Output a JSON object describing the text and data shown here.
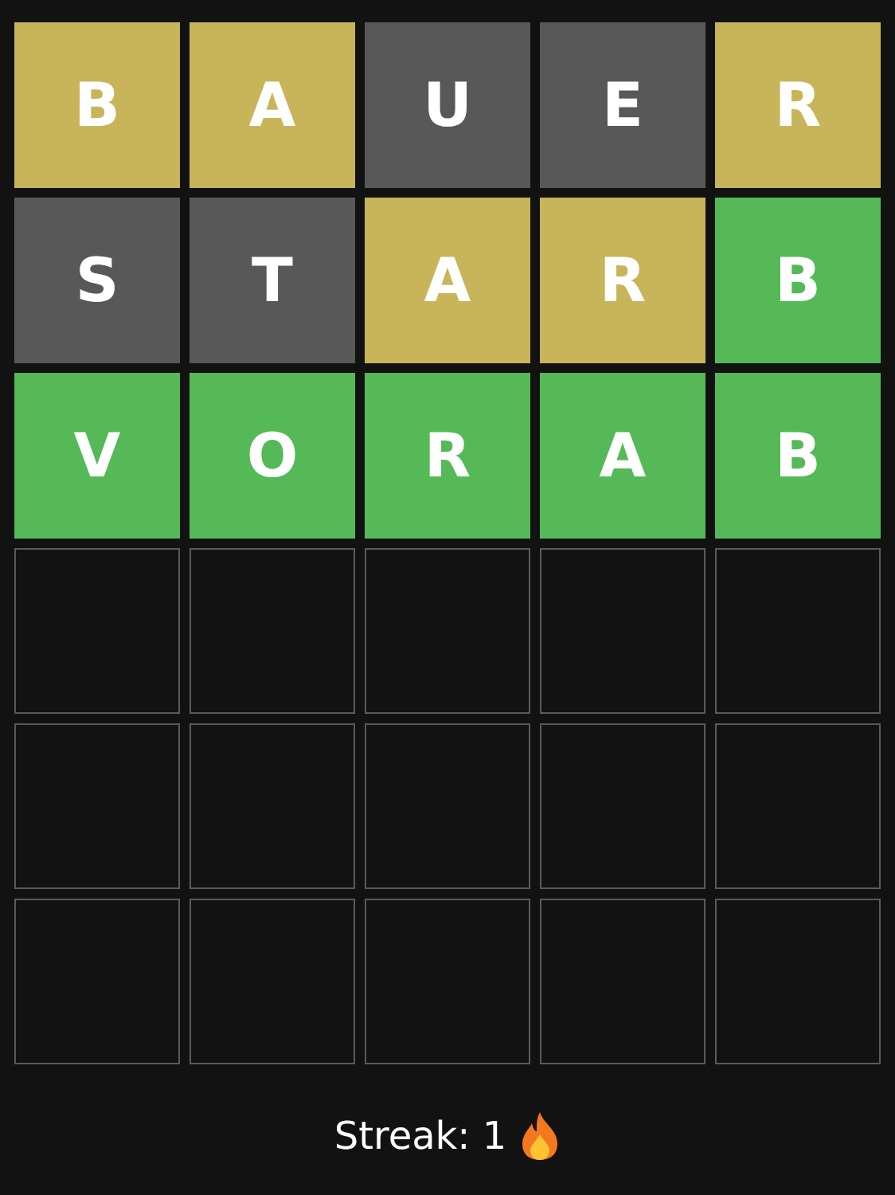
{
  "board": [
    [
      {
        "letter": "B",
        "kind": "present"
      },
      {
        "letter": "A",
        "kind": "present"
      },
      {
        "letter": "U",
        "kind": "absent"
      },
      {
        "letter": "E",
        "kind": "absent"
      },
      {
        "letter": "R",
        "kind": "present"
      }
    ],
    [
      {
        "letter": "S",
        "kind": "absent"
      },
      {
        "letter": "T",
        "kind": "absent"
      },
      {
        "letter": "A",
        "kind": "present"
      },
      {
        "letter": "R",
        "kind": "present"
      },
      {
        "letter": "B",
        "kind": "correct"
      }
    ],
    [
      {
        "letter": "V",
        "kind": "correct"
      },
      {
        "letter": "O",
        "kind": "correct"
      },
      {
        "letter": "R",
        "kind": "correct"
      },
      {
        "letter": "A",
        "kind": "correct"
      },
      {
        "letter": "B",
        "kind": "correct"
      }
    ],
    [
      {
        "kind": "empty"
      },
      {
        "kind": "empty"
      },
      {
        "kind": "empty"
      },
      {
        "kind": "empty"
      },
      {
        "kind": "empty"
      }
    ],
    [
      {
        "kind": "empty"
      },
      {
        "kind": "empty"
      },
      {
        "kind": "empty"
      },
      {
        "kind": "empty"
      },
      {
        "kind": "empty"
      }
    ],
    [
      {
        "kind": "empty"
      },
      {
        "kind": "empty"
      },
      {
        "kind": "empty"
      },
      {
        "kind": "empty"
      },
      {
        "kind": "empty"
      }
    ]
  ],
  "streak": "Streak: 1"
}
